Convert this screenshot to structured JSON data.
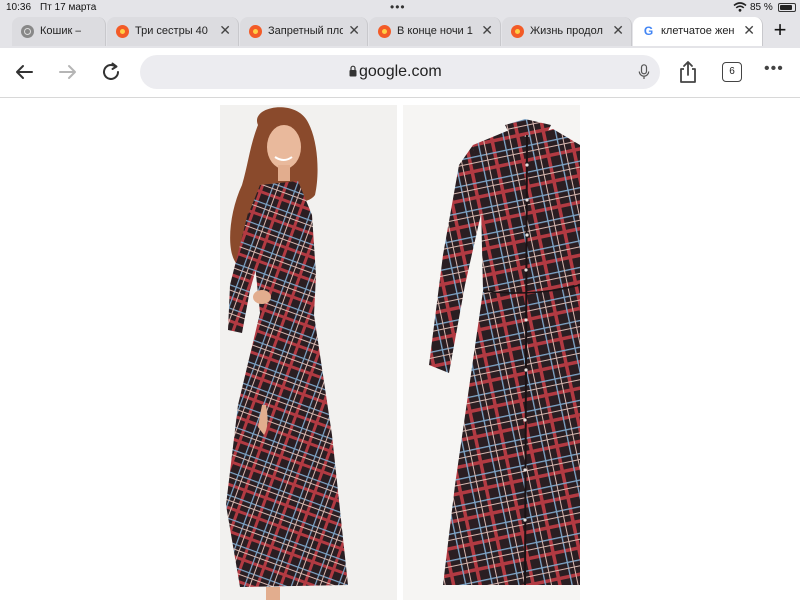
{
  "status_bar": {
    "time": "10:36",
    "date": "Пт 17 марта",
    "battery_percent_label": "85 %",
    "battery_level": 0.85
  },
  "tabs": [
    {
      "label": "Кошик — Pro",
      "icon": "globe-icon",
      "active": false
    },
    {
      "label": "Три сестры 40",
      "icon": "yandex-icon",
      "active": false
    },
    {
      "label": "Запретный пло",
      "icon": "yandex-icon",
      "active": false
    },
    {
      "label": "В конце ночи 1",
      "icon": "yandex-icon",
      "active": false
    },
    {
      "label": "Жизнь продол",
      "icon": "yandex-icon",
      "active": false
    },
    {
      "label": "клетчатое жен",
      "icon": "google-icon",
      "active": true
    }
  ],
  "toolbar": {
    "url": "google.com",
    "tab_count": "6"
  },
  "colors": {
    "chrome_bg": "#e4e4e8",
    "omnibox_bg": "#ececf0",
    "dress_base": "#2a1e22",
    "plaid_red": "#b23a42",
    "plaid_blue": "#7fa6c9"
  }
}
